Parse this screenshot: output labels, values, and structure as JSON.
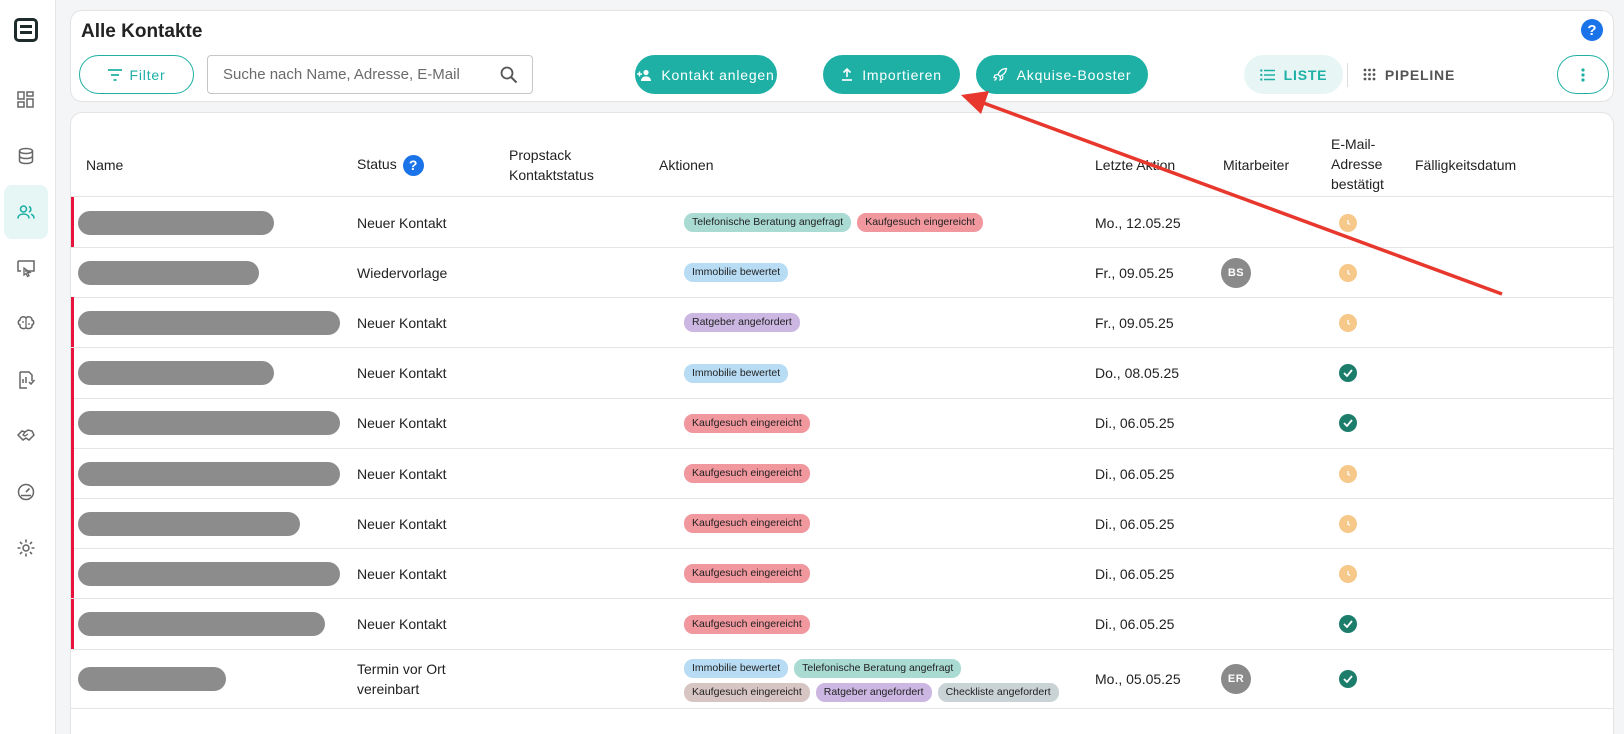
{
  "colors": {
    "accent": "#1eb0a5",
    "flag": "#e8123c",
    "help_blue": "#1a73e8",
    "pending": "#f6c98a",
    "confirmed": "#1c7d6b",
    "arrow": "#e8372c"
  },
  "sidebar": {
    "items": [
      {
        "icon": "dashboard-icon"
      },
      {
        "icon": "database-icon"
      },
      {
        "icon": "contacts-icon",
        "active": true
      },
      {
        "icon": "screen-touch-icon"
      },
      {
        "icon": "brain-icon"
      },
      {
        "icon": "report-check-icon"
      },
      {
        "icon": "handshake-icon"
      },
      {
        "icon": "gauge-icon"
      },
      {
        "icon": "gear-icon"
      }
    ]
  },
  "header": {
    "title": "Alle Kontakte",
    "help_label": "?",
    "filter_label": "Filter",
    "search_placeholder": "Suche nach Name, Adresse, E-Mail",
    "add_contact_label": "Kontakt anlegen",
    "import_label": "Importieren",
    "booster_label": "Akquise-Booster",
    "view_list_label": "LISTE",
    "view_pipeline_label": "PIPELINE"
  },
  "table": {
    "columns": {
      "name": "Name",
      "status": "Status",
      "status_help": "?",
      "propstack_1": "Propstack",
      "propstack_2": "Kontaktstatus",
      "actions": "Aktionen",
      "last_action": "Letzte Aktion",
      "employee": "Mitarbeiter",
      "email_1": "E-Mail-",
      "email_2": "Adresse",
      "email_3": "bestätigt",
      "due": "Fälligkeitsdatum"
    },
    "rows": [
      {
        "status": "Neuer Kontakt",
        "chips": [
          [
            "Telefonische Beratung angefragt",
            "teal"
          ],
          [
            "Kaufgesuch eingereicht",
            "red"
          ]
        ],
        "date": "Mo., 12.05.25",
        "avatar": "",
        "confirmed": false,
        "flag": true
      },
      {
        "status": "Wiedervorlage",
        "chips": [
          [
            "Immobilie bewertet",
            "blue"
          ]
        ],
        "date": "Fr., 09.05.25",
        "avatar": "BS",
        "confirmed": false,
        "flag": false
      },
      {
        "status": "Neuer Kontakt",
        "chips": [
          [
            "Ratgeber angefordert",
            "purple"
          ]
        ],
        "date": "Fr., 09.05.25",
        "avatar": "",
        "confirmed": false,
        "flag": true
      },
      {
        "status": "Neuer Kontakt",
        "chips": [
          [
            "Immobilie bewertet",
            "blue"
          ]
        ],
        "date": "Do., 08.05.25",
        "avatar": "",
        "confirmed": true,
        "flag": true
      },
      {
        "status": "Neuer Kontakt",
        "chips": [
          [
            "Kaufgesuch eingereicht",
            "red"
          ]
        ],
        "date": "Di., 06.05.25",
        "avatar": "",
        "confirmed": true,
        "flag": true
      },
      {
        "status": "Neuer Kontakt",
        "chips": [
          [
            "Kaufgesuch eingereicht",
            "red"
          ]
        ],
        "date": "Di., 06.05.25",
        "avatar": "",
        "confirmed": false,
        "flag": true
      },
      {
        "status": "Neuer Kontakt",
        "chips": [
          [
            "Kaufgesuch eingereicht",
            "red"
          ]
        ],
        "date": "Di., 06.05.25",
        "avatar": "",
        "confirmed": false,
        "flag": true
      },
      {
        "status": "Neuer Kontakt",
        "chips": [
          [
            "Kaufgesuch eingereicht",
            "red"
          ]
        ],
        "date": "Di., 06.05.25",
        "avatar": "",
        "confirmed": false,
        "flag": true
      },
      {
        "status": "Neuer Kontakt",
        "chips": [
          [
            "Kaufgesuch eingereicht",
            "red"
          ]
        ],
        "date": "Di., 06.05.25",
        "avatar": "",
        "confirmed": true,
        "flag": true
      },
      {
        "status": "Termin vor Ort vereinbart",
        "chips": [
          [
            "Immobilie bewertet",
            "blue"
          ],
          [
            "Telefonische Beratung angefragt",
            "teal"
          ],
          [
            "Kaufgesuch eingereicht",
            "brown"
          ],
          [
            "Ratgeber angefordert",
            "purple"
          ],
          [
            "Checkliste angefordert",
            "gray"
          ]
        ],
        "date": "Mo., 05.05.25",
        "avatar": "ER",
        "confirmed": true,
        "flag": false
      }
    ]
  }
}
